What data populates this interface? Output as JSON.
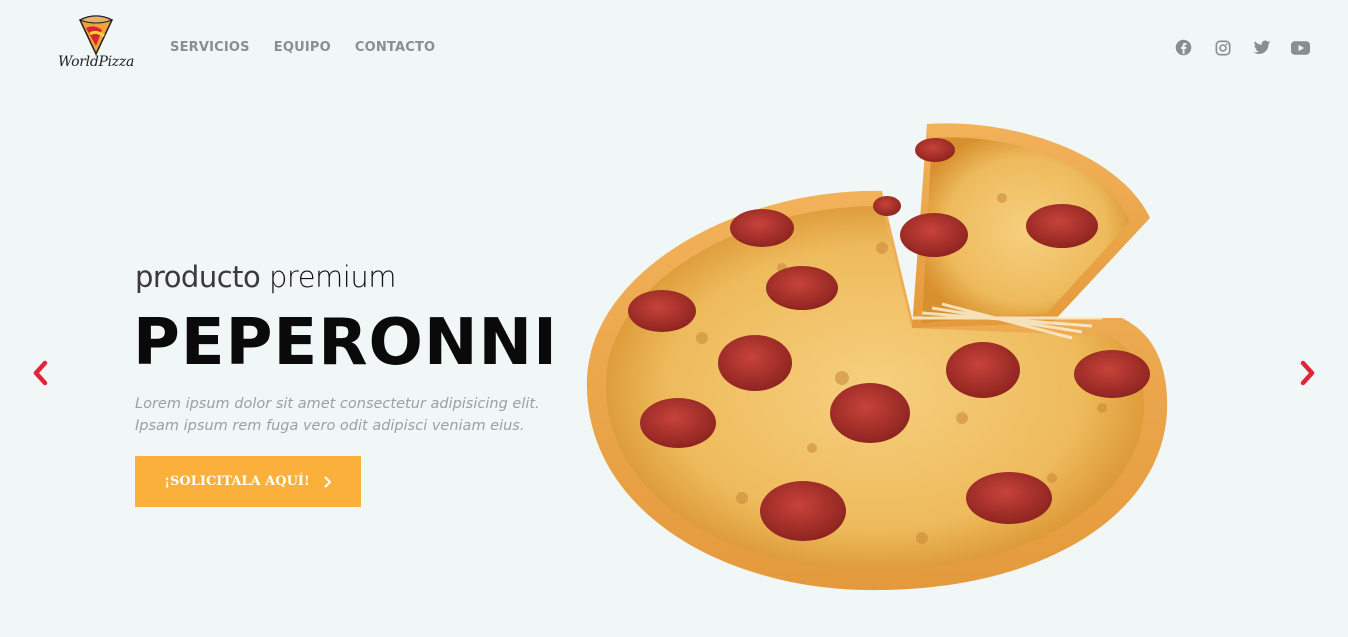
{
  "brand": {
    "logo_text": "WorldPizza"
  },
  "nav": {
    "items": [
      "SERVICIOS",
      "EQUIPO",
      "CONTACTO"
    ]
  },
  "social": [
    "facebook-icon",
    "instagram-icon",
    "twitter-icon",
    "youtube-icon"
  ],
  "hero": {
    "subtitle_light": "producto",
    "subtitle_strong": "premium",
    "title": "PEPERONNI",
    "description_line1": "Lorem ipsum dolor sit amet consectetur adipisicing elit.",
    "description_line2": "Ipsam ipsum rem fuga vero odit adipisci veniam eius.",
    "cta_label": "¡SOLICITALA AQUÍ!"
  },
  "colors": {
    "background": "#f1f6f7",
    "accent": "#fbb03b",
    "arrow": "#e0243a",
    "nav_text": "#8a8e91"
  }
}
